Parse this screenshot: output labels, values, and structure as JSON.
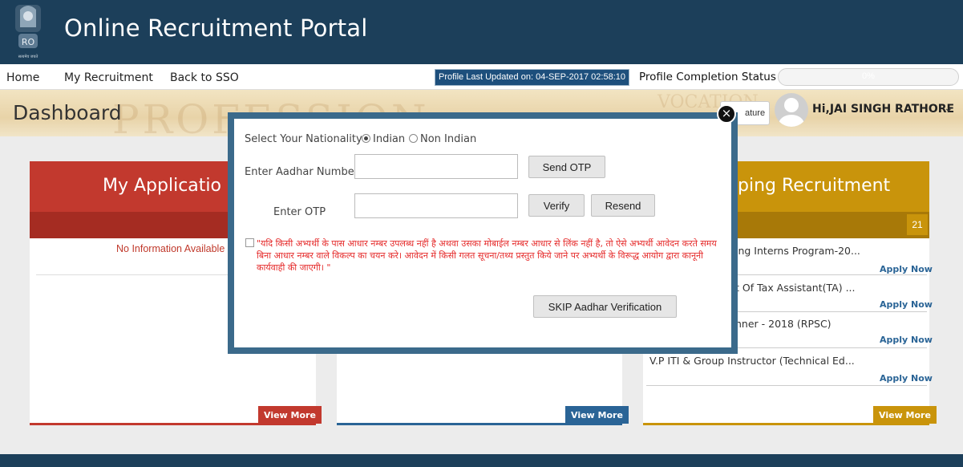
{
  "header": {
    "title": "Online Recruitment Portal",
    "emblem_caption": "सत्यमेव जयते",
    "emblem_text": "RO"
  },
  "nav": {
    "items": [
      "Home",
      "My Recruitment",
      "Back to SSO"
    ],
    "profile_updated": "Profile Last Updated on: 04-SEP-2017 02:58:10",
    "completion_label": "Profile Completion Status",
    "completion_value": "0%",
    "completion_fraction": 0
  },
  "banner": {
    "heading": "Dashboard",
    "watermark": "PROFESSION",
    "watermark2": "VOCATION",
    "signature_label": "ature",
    "user_name": "Hi,JAI SINGH RATHORE",
    "user_chevron": "⌄"
  },
  "cards": {
    "applications": {
      "title": "My Applicatio",
      "empty_text": "No Information Available",
      "view_more": "View More"
    },
    "middle": {
      "view_more": "View More"
    },
    "upcoming": {
      "title": "ping Recruitment",
      "count": "21",
      "items": [
        {
          "text": "ing Interns Program-20...",
          "action": "Apply Now"
        },
        {
          "text": "t Of Tax Assistant(TA) ...",
          "action": "Apply Now"
        },
        {
          "text": "nner - 2018 (RPSC)",
          "action": "Apply Now"
        },
        {
          "text": "V.P ITI & Group Instructor (Technical Ed...",
          "action": "Apply Now"
        }
      ],
      "view_more": "View More"
    }
  },
  "modal": {
    "close": "×",
    "nationality_label": "Select Your Nationality",
    "nationality_options": [
      "Indian",
      "Non Indian"
    ],
    "nationality_selected": "Indian",
    "aadhar_label": "Enter Aadhar Number",
    "aadhar_value": "",
    "otp_label": "Enter OTP",
    "otp_value": "",
    "send_otp": "Send OTP",
    "verify": "Verify",
    "resend": "Resend",
    "notice": "\"यदि किसी अभ्यर्थी के पास आधार नम्बर उपलब्ध नहीं है अथवा उसका मोबाईल नम्बर आधार से लिंक नहीं है, तो ऐसे अभ्यर्थी आवेदन करते समय बिना आधार नम्बर वाले विकल्प का चयन करे। आवेदन में किसी गलत सूचना/तथ्य प्रस्तुत किये जाने पर अभ्यर्थी के विरूद्ध आयोग द्वारा कानूनी कार्यवाही की जाएगी। \"",
    "skip_button": "SKIP Aadhar Verification"
  },
  "colors": {
    "header_bg": "#1c3f5a",
    "card_red": "#c2392e",
    "card_blue": "#2a6496",
    "card_gold": "#c9940b",
    "notice_red": "#e52b2b"
  }
}
